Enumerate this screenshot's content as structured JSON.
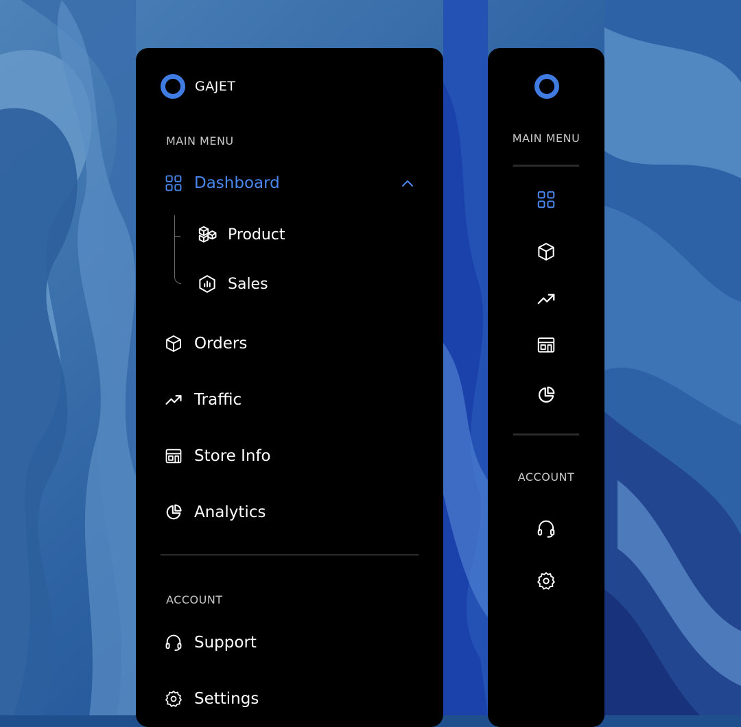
{
  "brand": {
    "name": "GAJET",
    "accent_color": "#3f7be0"
  },
  "expanded_sidebar": {
    "main_menu_label": "MAIN MENU",
    "dashboard": {
      "label": "Dashboard",
      "icon": "grid-icon",
      "expanded": true
    },
    "submenu": [
      {
        "label": "Product",
        "icon": "boxes-icon"
      },
      {
        "label": "Sales",
        "icon": "hexagon-chart-icon"
      }
    ],
    "items": [
      {
        "label": "Orders",
        "icon": "cube-icon"
      },
      {
        "label": "Traffic",
        "icon": "trending-up-icon"
      },
      {
        "label": "Store Info",
        "icon": "store-icon"
      },
      {
        "label": "Analytics",
        "icon": "pie-chart-icon"
      }
    ],
    "account_label": "ACCOUNT",
    "account_items": [
      {
        "label": "Support",
        "icon": "headset-icon"
      },
      {
        "label": "Settings",
        "icon": "gear-icon"
      }
    ]
  },
  "collapsed_sidebar": {
    "main_menu_label": "MAIN MENU",
    "account_label": "ACCOUNT",
    "icons": [
      "grid-icon",
      "cube-icon",
      "trending-up-icon",
      "store-icon",
      "pie-chart-icon",
      "headset-icon",
      "gear-icon"
    ]
  },
  "colors": {
    "active": "#4a88f0",
    "panel": "#000000",
    "divider": "#2b2b2b"
  }
}
